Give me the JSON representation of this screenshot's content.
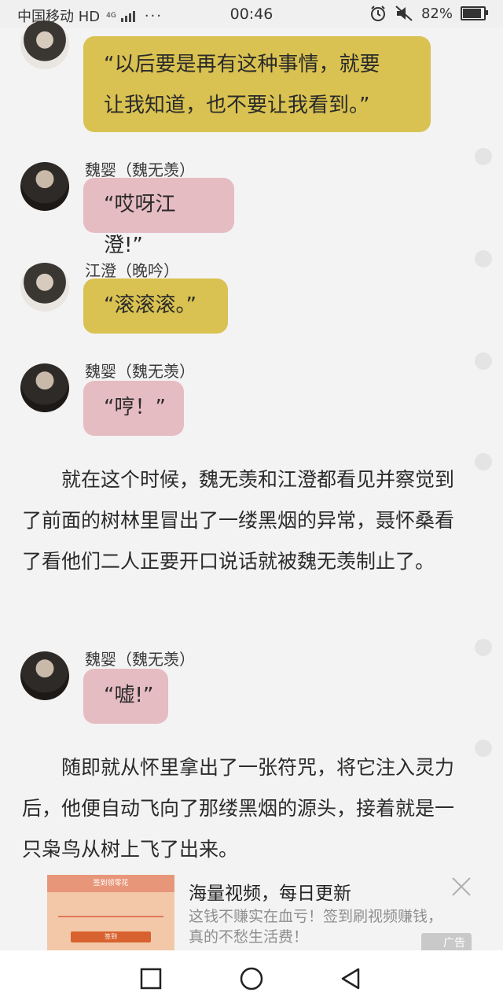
{
  "statusbar": {
    "carrier": "中国移动 HD",
    "network": "4G",
    "time": "00:46",
    "battery": "82%",
    "dots": "···"
  },
  "messages": [
    {
      "speaker": "江澄（晚吟）",
      "avatar": "jiang-cheng-avatar",
      "text_line1": "“以后要是再有这种事情，就要",
      "text_line2": "让我知道，也不要让我看到。”",
      "color": "#d9c251"
    },
    {
      "speaker": "魏婴（魏无羡）",
      "avatar": "wei-ying-avatar",
      "text": "“哎呀江澄!”",
      "color": "#e6bcc3"
    },
    {
      "speaker": "江澄（晚吟）",
      "avatar": "jiang-cheng-avatar",
      "text": "“滚滚滚。”",
      "color": "#d9c251"
    },
    {
      "speaker": "魏婴（魏无羡）",
      "avatar": "wei-ying-avatar",
      "text": "“哼！”",
      "color": "#e6bcc3"
    },
    {
      "speaker": "魏婴（魏无羡）",
      "avatar": "wei-ying-avatar",
      "text": "“嘘!”",
      "color": "#e6bcc3"
    }
  ],
  "paragraphs": [
    "就在这个时候，魏无羡和江澄都看见并察觉到了前面的树林里冒出了一缕黑烟的异常，聂怀桑看了看他们二人正要开口说话就被魏无羡制止了。",
    "随即就从怀里拿出了一张符咒，将它注入灵力后，他便自动飞向了那缕黑烟的源头，接着就是一只枭鸟从树上飞了出来。"
  ],
  "ad": {
    "thumb_title": "签到领零花",
    "thumb_button": "签到",
    "title": "海量视频，每日更新",
    "description": "这钱不赚实在血亏！签到刷视频赚钱，真的不愁生活费！",
    "tag": "广告"
  },
  "navbar": {
    "icons": [
      "square-icon",
      "circle-icon",
      "triangle-back-icon"
    ]
  }
}
